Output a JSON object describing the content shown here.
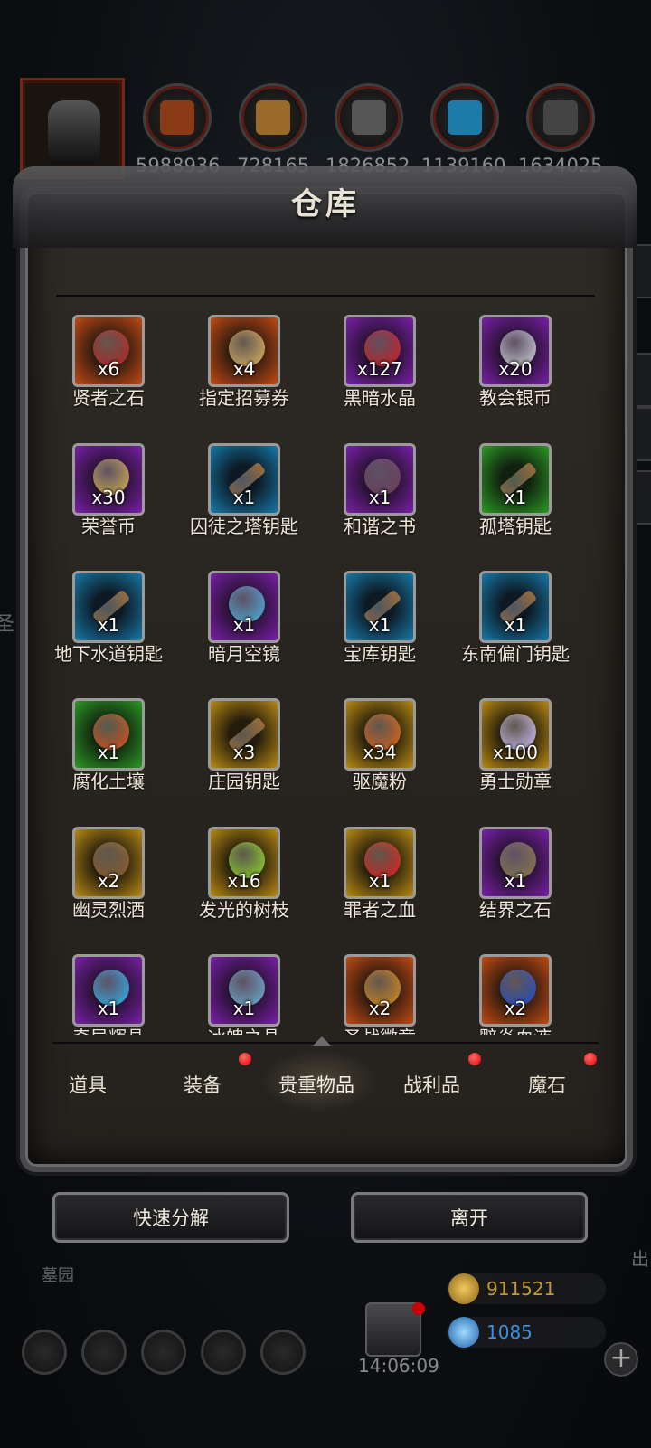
{
  "background": {
    "left_text": "圣",
    "bottom_left_text": "墓园",
    "bottom_right_text": "出"
  },
  "top_resources": [
    {
      "icon": "meat-icon",
      "value": "5988936"
    },
    {
      "icon": "wood-icon",
      "value": "728165"
    },
    {
      "icon": "iron-icon",
      "value": "1826852"
    },
    {
      "icon": "crystal-icon",
      "value": "1139160"
    },
    {
      "icon": "stone-icon",
      "value": "1634025"
    }
  ],
  "panel": {
    "title": "仓库"
  },
  "items": [
    {
      "name": "贤者之石",
      "count": "x6",
      "rarity": "orange",
      "icon": "red-stone-icon"
    },
    {
      "name": "指定招募券",
      "count": "x4",
      "rarity": "orange",
      "icon": "scroll-icon"
    },
    {
      "name": "黑暗水晶",
      "count": "x127",
      "rarity": "purple",
      "icon": "dark-crystal-icon"
    },
    {
      "name": "教会银币",
      "count": "x20",
      "rarity": "purple",
      "icon": "silver-coin-icon"
    },
    {
      "name": "荣誉币",
      "count": "x30",
      "rarity": "purple",
      "icon": "gold-coin-icon"
    },
    {
      "name": "囚徒之塔钥匙",
      "count": "x1",
      "rarity": "blue",
      "icon": "key-icon"
    },
    {
      "name": "和谐之书",
      "count": "x1",
      "rarity": "purple",
      "icon": "book-icon"
    },
    {
      "name": "孤塔钥匙",
      "count": "x1",
      "rarity": "green",
      "icon": "key-icon"
    },
    {
      "name": "地下水道钥匙",
      "count": "x1",
      "rarity": "blue",
      "icon": "key-icon"
    },
    {
      "name": "暗月空镜",
      "count": "x1",
      "rarity": "purple",
      "icon": "mirror-icon"
    },
    {
      "name": "宝库钥匙",
      "count": "x1",
      "rarity": "blue",
      "icon": "key-icon"
    },
    {
      "name": "东南偏门钥匙",
      "count": "x1",
      "rarity": "blue",
      "icon": "key-icon"
    },
    {
      "name": "腐化土壤",
      "count": "x1",
      "rarity": "green",
      "icon": "soil-icon"
    },
    {
      "name": "庄园钥匙",
      "count": "x3",
      "rarity": "gold",
      "icon": "key-icon"
    },
    {
      "name": "驱魔粉",
      "count": "x34",
      "rarity": "gold",
      "icon": "powder-icon"
    },
    {
      "name": "勇士勋章",
      "count": "x100",
      "rarity": "gold",
      "icon": "medal-icon"
    },
    {
      "name": "幽灵烈酒",
      "count": "x2",
      "rarity": "gold",
      "icon": "barrel-icon"
    },
    {
      "name": "发光的树枝",
      "count": "x16",
      "rarity": "gold",
      "icon": "branch-icon"
    },
    {
      "name": "罪者之血",
      "count": "x1",
      "rarity": "gold",
      "icon": "blood-drop-icon"
    },
    {
      "name": "结界之石",
      "count": "x1",
      "rarity": "purple",
      "icon": "barrier-stone-icon"
    },
    {
      "name": "奇异辉晶",
      "count": "x1",
      "rarity": "purple",
      "icon": "blue-crystal-icon"
    },
    {
      "name": "冰魄之晶",
      "count": "x1",
      "rarity": "purple",
      "icon": "ice-crystal-icon"
    },
    {
      "name": "圣战徽章",
      "count": "x2",
      "rarity": "orange",
      "icon": "crusade-badge-icon"
    },
    {
      "name": "黯炎血液",
      "count": "x2",
      "rarity": "orange",
      "icon": "dark-flame-icon"
    }
  ],
  "tabs": [
    {
      "label": "道具",
      "badge": false,
      "active": false
    },
    {
      "label": "装备",
      "badge": true,
      "active": false
    },
    {
      "label": "贵重物品",
      "badge": false,
      "active": true
    },
    {
      "label": "战利品",
      "badge": true,
      "active": false
    },
    {
      "label": "魔石",
      "badge": true,
      "active": false
    }
  ],
  "buttons": {
    "quick_decompose": "快速分解",
    "leave": "离开"
  },
  "hud": {
    "time": "14:06:09",
    "gold": "911521",
    "gems": "1085",
    "colors": {
      "gold": "#c29a2e",
      "gems": "#3f8fd6"
    }
  },
  "rarity_colors": {
    "orange": "#c24a12",
    "purple": "#7a1fa8",
    "blue": "#1679a8",
    "green": "#2b9a24",
    "gold": "#b88a14"
  }
}
